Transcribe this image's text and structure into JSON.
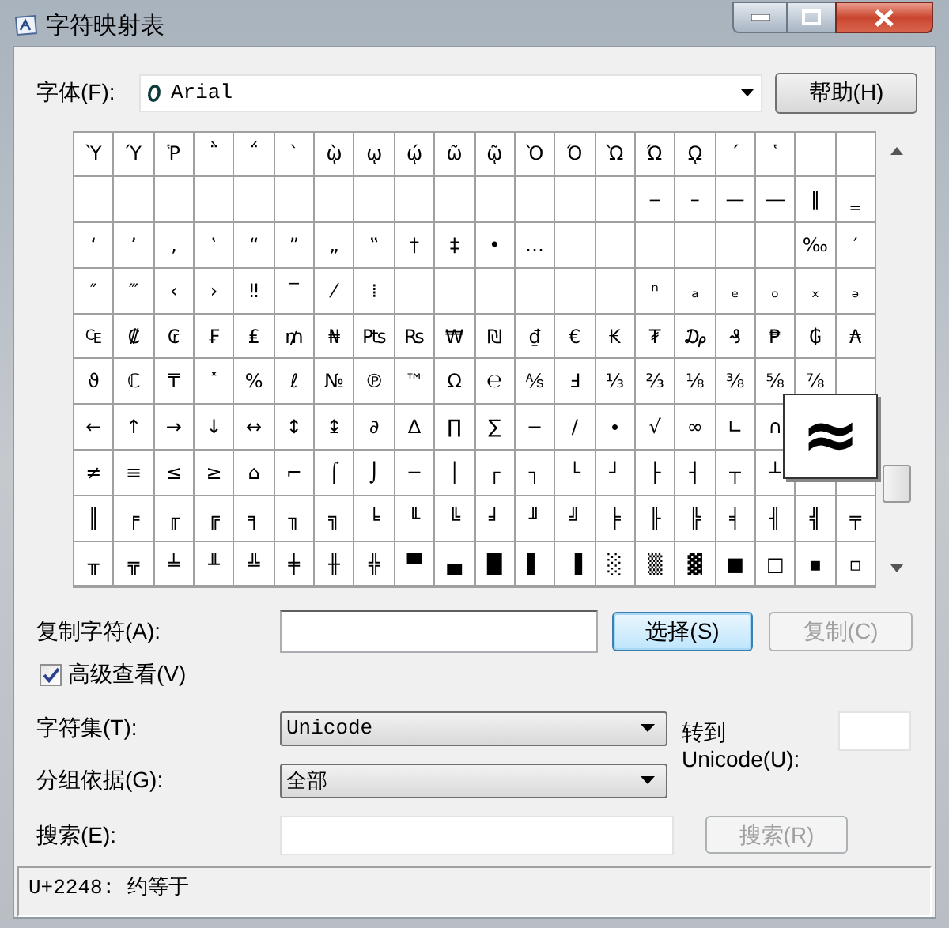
{
  "window": {
    "title": "字符映射表"
  },
  "font": {
    "label": "字体(F):",
    "value": "Arial"
  },
  "help_button": "帮助(H)",
  "character_grid": {
    "rows": [
      [
        "Ὺ",
        "Ύ",
        "Ῥ",
        "῭",
        "΅",
        "`",
        "ῲ",
        "ῳ",
        "ῴ",
        "ῶ",
        "ῷ",
        "Ὸ",
        "Ό",
        "Ὼ",
        "Ώ",
        "ῼ",
        "´",
        "῾",
        null,
        null
      ],
      [
        null,
        null,
        null,
        null,
        null,
        null,
        null,
        null,
        null,
        null,
        null,
        null,
        null,
        null,
        "‒",
        "–",
        "—",
        "―",
        "‖",
        "‗"
      ],
      [
        "‘",
        "’",
        "‚",
        "‛",
        "“",
        "”",
        "„",
        "‟",
        "†",
        "‡",
        "•",
        "…",
        null,
        null,
        null,
        null,
        null,
        null,
        "‰",
        "′"
      ],
      [
        "″",
        "‴",
        "‹",
        "›",
        "‼",
        "‾",
        "⁄",
        "⁞",
        null,
        null,
        null,
        null,
        null,
        null,
        "ⁿ",
        "ₐ",
        "ₑ",
        "ₒ",
        "ₓ",
        "ₔ"
      ],
      [
        "₠",
        "₡",
        "₢",
        "₣",
        "₤",
        "₥",
        "₦",
        "₧",
        "₨",
        "₩",
        "₪",
        "₫",
        "€",
        "₭",
        "₮",
        "₯",
        "₰",
        "₱",
        "₲",
        "₳"
      ],
      [
        "ϑ",
        "ℂ",
        "₸",
        "˟",
        "%",
        "ℓ",
        "№",
        "℗",
        "™",
        "Ω",
        "℮",
        "⅍",
        "Ⅎ",
        "⅓",
        "⅔",
        "⅛",
        "⅜",
        "⅝",
        "⅞",
        null
      ],
      [
        "←",
        "↑",
        "→",
        "↓",
        "↔",
        "↕",
        "↨",
        "∂",
        "∆",
        "∏",
        "∑",
        "−",
        "∕",
        "∙",
        "√",
        "∞",
        "∟",
        "∩",
        null,
        null
      ],
      [
        "≠",
        "≡",
        "≤",
        "≥",
        "⌂",
        "⌐",
        "⌠",
        "⌡",
        "─",
        "│",
        "┌",
        "┐",
        "└",
        "┘",
        "├",
        "┤",
        "┬",
        "┴",
        null,
        null
      ],
      [
        "║",
        "╒",
        "╓",
        "╔",
        "╕",
        "╖",
        "╗",
        "╘",
        "╙",
        "╚",
        "╛",
        "╜",
        "╝",
        "╞",
        "╟",
        "╠",
        "╡",
        "╢",
        "╣",
        "╤"
      ],
      [
        "╥",
        "╦",
        "╧",
        "╨",
        "╩",
        "╪",
        "╫",
        "╬",
        "▀",
        "▄",
        "█",
        "▌",
        "▐",
        "░",
        "▒",
        "▓",
        "■",
        "□",
        "▪",
        "▫"
      ]
    ]
  },
  "magnifier": {
    "char": "≈"
  },
  "copy": {
    "label": "复制字符(A):",
    "select_button": "选择(S)",
    "copy_button": {
      "label": "复制(C)",
      "disabled": true
    }
  },
  "advanced_view": {
    "label": "高级查看(V)",
    "checked": true
  },
  "character_set": {
    "label": "字符集(T):",
    "value": "Unicode"
  },
  "go_to_unicode": {
    "label": "转到 Unicode(U):"
  },
  "group_by": {
    "label": "分组依据(G):",
    "value": "全部"
  },
  "search": {
    "label": "搜索(E):",
    "button": {
      "label": "搜索(R)",
      "disabled": true
    }
  },
  "status_bar": "U+2248: 约等于"
}
